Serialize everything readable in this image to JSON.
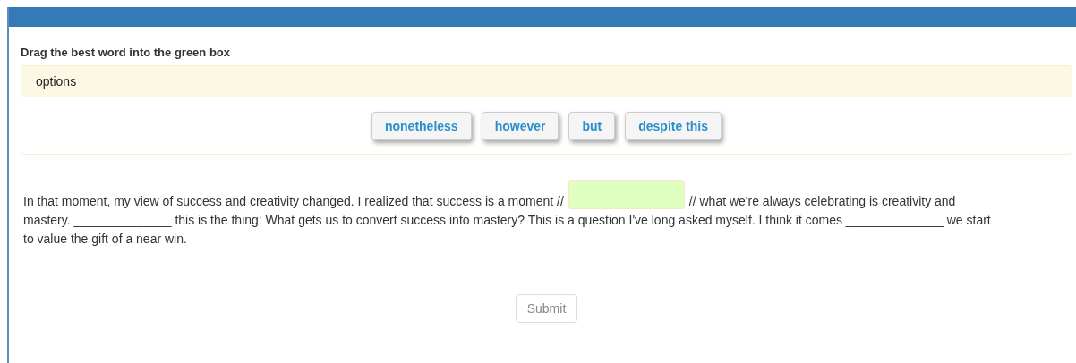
{
  "instruction": "Drag the best word into the green box",
  "options": {
    "heading": "options",
    "words": [
      "nonetheless",
      "however",
      "but",
      "despite this"
    ]
  },
  "passage": [
    [
      {
        "kind": "text",
        "text": "In that moment, my view of success and creativity changed. I realized that success is a moment //"
      },
      {
        "kind": "dropzone"
      },
      {
        "kind": "text",
        "text": "// what we're always celebrating is creativity and"
      }
    ],
    [
      {
        "kind": "text",
        "text": "mastery. ______________ this is the thing: What gets us to convert success into mastery? This is a question I've long asked myself. I think it comes ______________ we start"
      }
    ],
    [
      {
        "kind": "text",
        "text": "to value the gift of a near win."
      }
    ]
  ],
  "submit": {
    "label": "Submit",
    "disabled": true
  }
}
